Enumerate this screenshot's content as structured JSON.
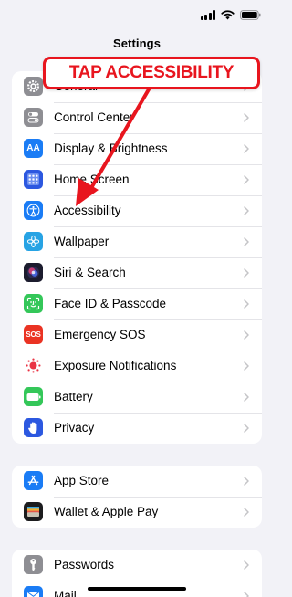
{
  "header": {
    "title": "Settings"
  },
  "callout": {
    "text": "TAP ACCESSIBILITY"
  },
  "groups": [
    {
      "items": [
        {
          "label": "General",
          "icon": "gear-icon",
          "color": "#8e8e93"
        },
        {
          "label": "Control Center",
          "icon": "toggle-icon",
          "color": "#8e8e93"
        },
        {
          "label": "Display & Brightness",
          "icon": "aa-icon",
          "color": "#1a7cf5"
        },
        {
          "label": "Home Screen",
          "icon": "grid-icon",
          "color": "#2c58e0"
        },
        {
          "label": "Accessibility",
          "icon": "accessibility-icon",
          "color": "#1a7cf5"
        },
        {
          "label": "Wallpaper",
          "icon": "flower-icon",
          "color": "#27a3e4"
        },
        {
          "label": "Siri & Search",
          "icon": "siri-icon",
          "color": "#1c1c2e"
        },
        {
          "label": "Face ID & Passcode",
          "icon": "faceid-icon",
          "color": "#34c759"
        },
        {
          "label": "Emergency SOS",
          "icon": "sos-icon",
          "color": "#ea3323",
          "icon_text": "SOS"
        },
        {
          "label": "Exposure Notifications",
          "icon": "exposure-icon",
          "color": "#ffffff"
        },
        {
          "label": "Battery",
          "icon": "battery-icon",
          "color": "#34c759"
        },
        {
          "label": "Privacy",
          "icon": "hand-icon",
          "color": "#2c58e0"
        }
      ]
    },
    {
      "items": [
        {
          "label": "App Store",
          "icon": "appstore-icon",
          "color": "#1a7cf5"
        },
        {
          "label": "Wallet & Apple Pay",
          "icon": "wallet-icon",
          "color": "#1c1c1e"
        }
      ]
    },
    {
      "items": [
        {
          "label": "Passwords",
          "icon": "key-icon",
          "color": "#8e8e93"
        },
        {
          "label": "Mail",
          "icon": "mail-icon",
          "color": "#1a7cf5"
        }
      ]
    }
  ],
  "colors": {
    "accent_red": "#e8151e",
    "background": "#f2f2f7"
  }
}
